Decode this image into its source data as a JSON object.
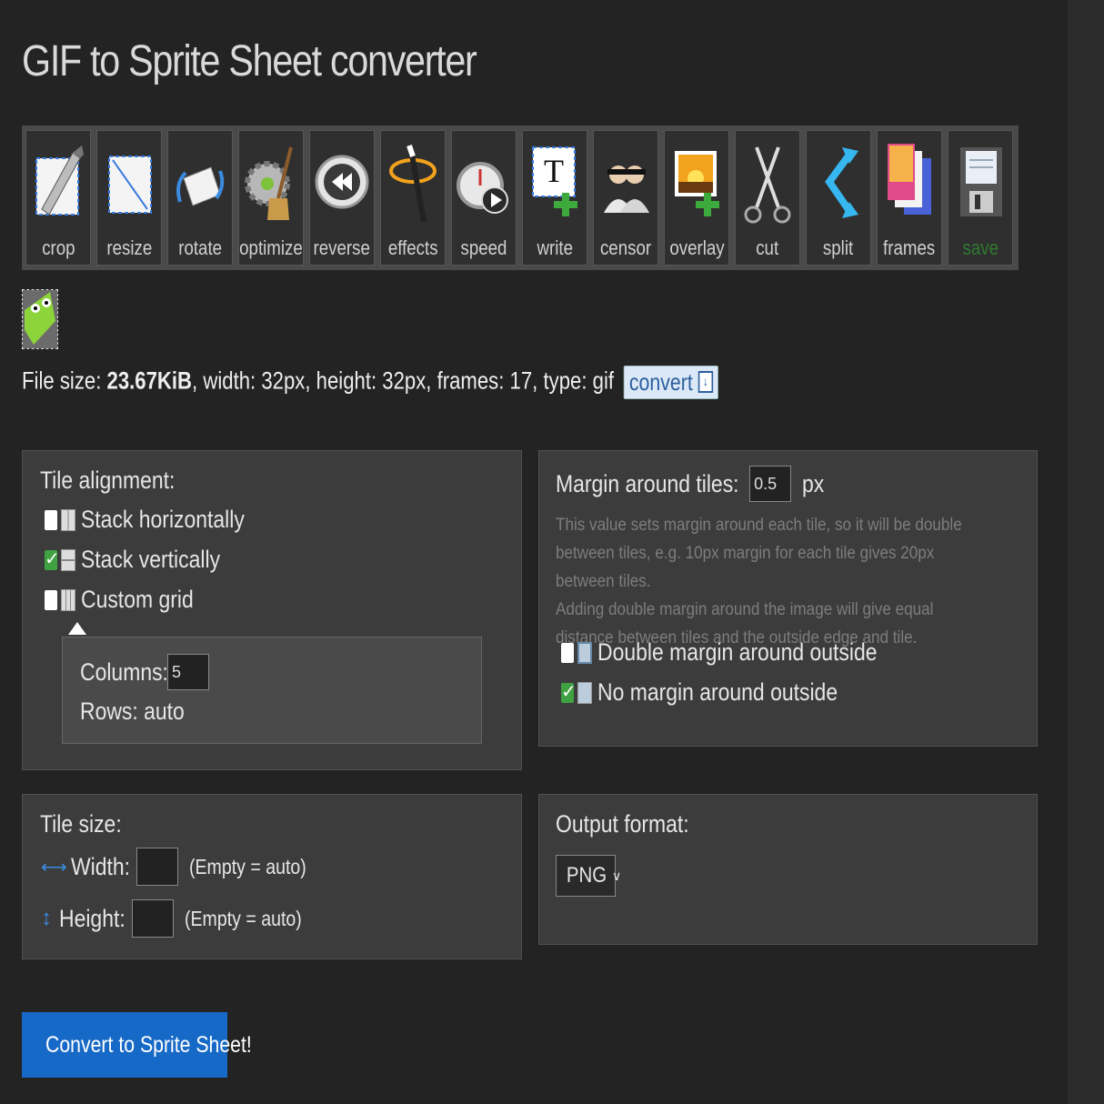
{
  "page_title": "GIF to Sprite Sheet converter",
  "toolbar": [
    {
      "label": "crop",
      "icon": "crop-icon"
    },
    {
      "label": "resize",
      "icon": "resize-icon"
    },
    {
      "label": "rotate",
      "icon": "rotate-icon"
    },
    {
      "label": "optimize",
      "icon": "optimize-icon"
    },
    {
      "label": "reverse",
      "icon": "reverse-icon"
    },
    {
      "label": "effects",
      "icon": "effects-icon"
    },
    {
      "label": "speed",
      "icon": "speed-icon"
    },
    {
      "label": "write",
      "icon": "write-icon"
    },
    {
      "label": "censor",
      "icon": "censor-icon"
    },
    {
      "label": "overlay",
      "icon": "overlay-icon"
    },
    {
      "label": "cut",
      "icon": "cut-icon"
    },
    {
      "label": "split",
      "icon": "split-icon"
    },
    {
      "label": "frames",
      "icon": "frames-icon"
    },
    {
      "label": "save",
      "icon": "save-icon"
    }
  ],
  "file_info": {
    "size_label": "File size: ",
    "size_value": "23.67KiB",
    "rest": ", width: 32px, height: 32px, frames: 17, type: gif",
    "convert_label": "convert"
  },
  "tile_alignment": {
    "heading": "Tile alignment:",
    "options": [
      {
        "label": "Stack horizontally",
        "checked": false
      },
      {
        "label": "Stack vertically",
        "checked": true
      },
      {
        "label": "Custom grid",
        "checked": false
      }
    ],
    "columns_label": "Columns:",
    "columns_value": "5",
    "rows_label": "Rows: auto"
  },
  "margin": {
    "label": "Margin around tiles:",
    "value": "0.5",
    "unit": "px",
    "help1": "This value sets margin around each tile, so it will be double between tiles, e.g. 10px margin for each tile gives 20px between tiles.",
    "help2": "Adding double margin around the image will give equal distance between tiles and the outside edge and tile.",
    "options": [
      {
        "label": "Double margin around outside",
        "checked": false
      },
      {
        "label": "No margin around outside",
        "checked": true
      }
    ]
  },
  "tile_size": {
    "heading": "Tile size:",
    "width_label": "Width:",
    "height_label": "Height:",
    "hint": "(Empty = auto)"
  },
  "output": {
    "heading": "Output format:",
    "selected": "PNG"
  },
  "primary_button": "Convert to Sprite Sheet!",
  "colors": {
    "accent": "#1669c7",
    "save_label": "#2f7a2f",
    "check": "#3fa142"
  }
}
